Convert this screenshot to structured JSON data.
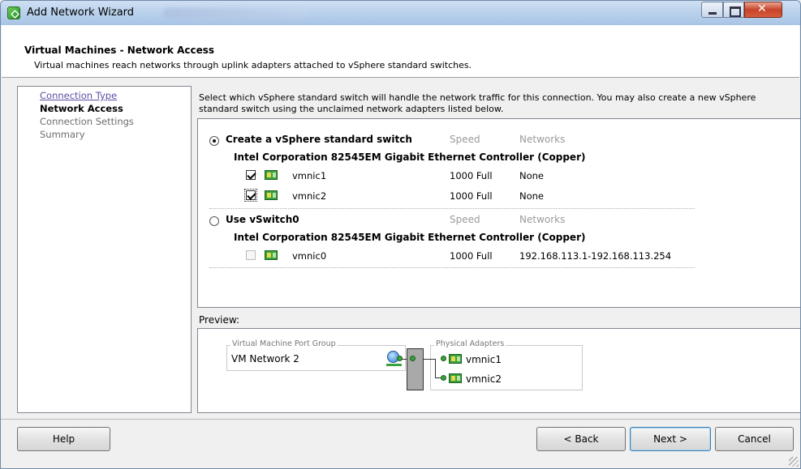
{
  "window": {
    "title": "Add Network Wizard"
  },
  "header": {
    "title": "Virtual Machines - Network Access",
    "subtitle": "Virtual machines reach networks through uplink adapters attached to vSphere standard switches."
  },
  "nav": {
    "items": [
      {
        "label": "Connection Type",
        "state": "link"
      },
      {
        "label": "Network Access",
        "state": "active"
      },
      {
        "label": "Connection Settings",
        "state": "disabled"
      },
      {
        "label": "Summary",
        "state": "disabled"
      }
    ]
  },
  "main": {
    "instructions": "Select which vSphere standard switch will handle the network traffic for this connection. You may also create a new vSphere standard switch using the unclaimed network adapters listed below.",
    "options": [
      {
        "label": "Create a vSphere standard switch",
        "selected": true,
        "speed_header": "Speed",
        "networks_header": "Networks",
        "adapter_group": "Intel Corporation 82545EM Gigabit Ethernet Controller (Copper)",
        "nics": [
          {
            "name": "vmnic1",
            "checked": true,
            "speed": "1000 Full",
            "networks": "None"
          },
          {
            "name": "vmnic2",
            "checked": true,
            "speed": "1000 Full",
            "networks": "None"
          }
        ]
      },
      {
        "label": "Use vSwitch0",
        "selected": false,
        "speed_header": "Speed",
        "networks_header": "Networks",
        "adapter_group": "Intel Corporation 82545EM Gigabit Ethernet Controller (Copper)",
        "nics": [
          {
            "name": "vmnic0",
            "checked": false,
            "speed": "1000 Full",
            "networks": "192.168.113.1-192.168.113.254"
          }
        ]
      }
    ]
  },
  "preview": {
    "label": "Preview:",
    "port_group_caption": "Virtual Machine Port Group",
    "port_group_name": "VM Network 2",
    "adapters_caption": "Physical Adapters",
    "adapters": [
      "vmnic1",
      "vmnic2"
    ]
  },
  "buttons": {
    "help": "Help",
    "back": "< Back",
    "next": "Next >",
    "cancel": "Cancel"
  },
  "colors": {
    "titlebar": "#b9d1ec",
    "link": "#5a4fa5",
    "nic_green": "#3aa23c"
  }
}
